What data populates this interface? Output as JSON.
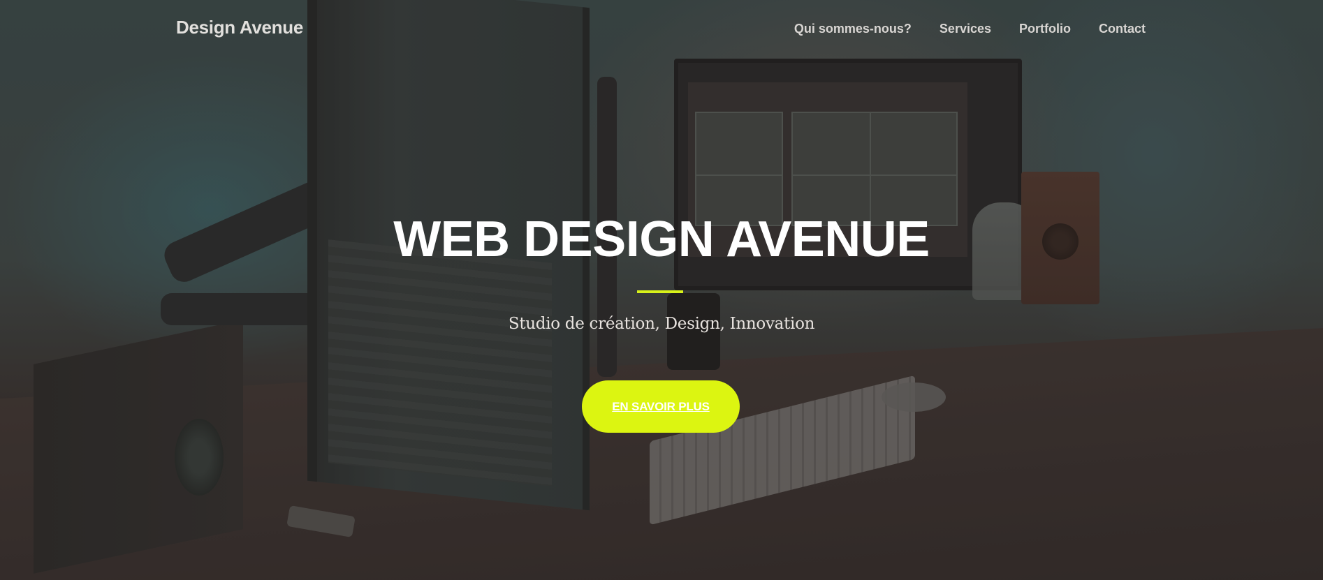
{
  "nav": {
    "brand": "Design Avenue",
    "links": [
      {
        "label": "Qui sommes-nous?"
      },
      {
        "label": "Services"
      },
      {
        "label": "Portfolio"
      },
      {
        "label": "Contact"
      }
    ]
  },
  "hero": {
    "title": "WEB DESIGN AVENUE",
    "subtitle": "Studio de création, Design, Innovation",
    "cta_label": "EN SAVOIR PLUS"
  },
  "colors": {
    "accent": "#dcf511",
    "overlay": "#3e3533",
    "text": "#ffffff"
  }
}
